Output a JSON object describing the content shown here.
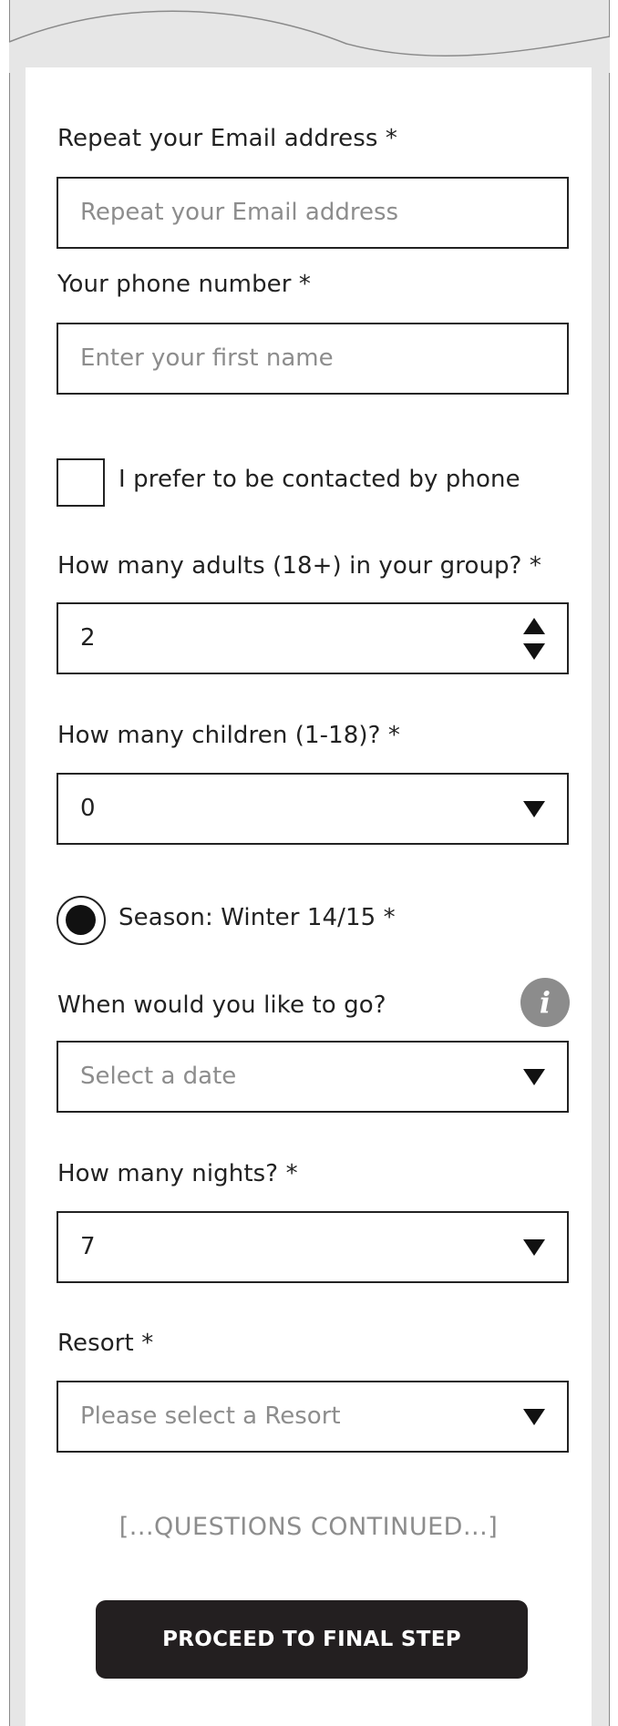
{
  "form": {
    "repeat_email": {
      "label": "Repeat your Email address *",
      "placeholder": "Repeat your Email address"
    },
    "phone": {
      "label": "Your phone number *",
      "placeholder": "Enter your first name"
    },
    "contact_by_phone": {
      "label": "I prefer to be contacted by phone",
      "checked": false
    },
    "adults": {
      "label": "How many adults (18+) in your group? *",
      "value": "2"
    },
    "children": {
      "label": "How many children (1-18)? *",
      "value": "0"
    },
    "season": {
      "label": "Season: Winter 14/15 *",
      "selected": true
    },
    "travel_date": {
      "label": "When would you like to go?",
      "placeholder": "Select a date",
      "info_icon": "info-icon"
    },
    "nights": {
      "label": "How many nights? *",
      "value": "7"
    },
    "resort": {
      "label": "Resort *",
      "placeholder": "Please select a Resort"
    },
    "continued_note": "[...QUESTIONS CONTINUED...]",
    "proceed_label": "PROCEED TO FINAL STEP"
  },
  "colors": {
    "frame_background": "#e6e6e6",
    "card_background": "#ffffff",
    "field_border": "#222222",
    "placeholder_text": "#8d8d8d",
    "button_background": "#231f20",
    "button_text": "#ffffff",
    "info_icon_background": "#8c8c8c"
  }
}
